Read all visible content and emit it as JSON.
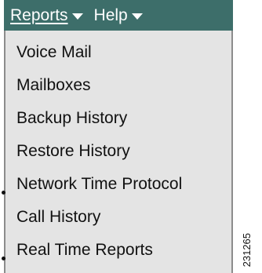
{
  "menubar": {
    "items": [
      {
        "label": "Reports",
        "icon": "caret-down-icon"
      },
      {
        "label": "Help",
        "icon": "caret-down-icon"
      }
    ]
  },
  "dropdown": {
    "items": [
      {
        "label": "Voice Mail"
      },
      {
        "label": "Mailboxes"
      },
      {
        "label": "Backup History"
      },
      {
        "label": "Restore History"
      },
      {
        "label": "Network Time Protocol"
      },
      {
        "label": "Call History"
      },
      {
        "label": "Real Time Reports"
      }
    ]
  },
  "figure_id": "231265",
  "colors": {
    "menubar_bg": "#3d6e6a",
    "dropdown_bg": "#e4e4e4"
  }
}
